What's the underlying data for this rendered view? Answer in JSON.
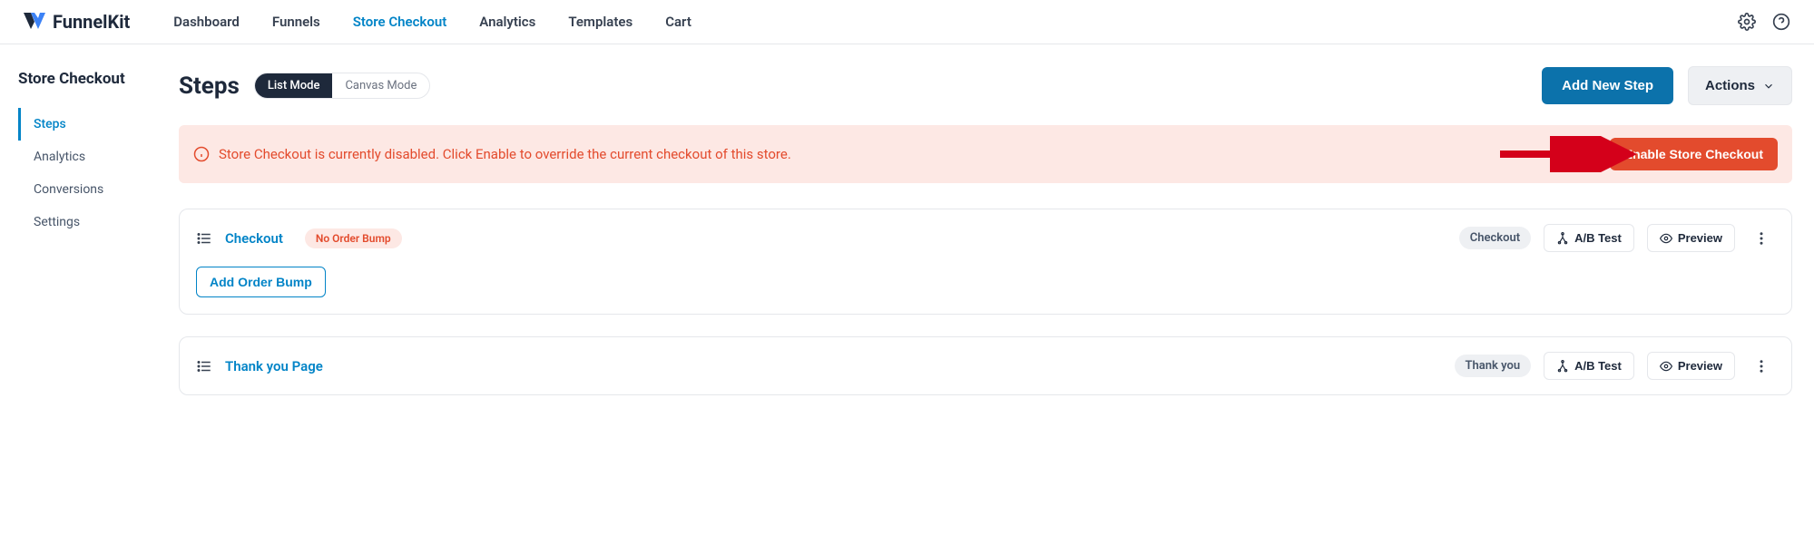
{
  "brand": {
    "name": "FunnelKit"
  },
  "nav": {
    "dashboard": "Dashboard",
    "funnels": "Funnels",
    "store_checkout": "Store Checkout",
    "analytics": "Analytics",
    "templates": "Templates",
    "cart": "Cart"
  },
  "sidebar": {
    "title": "Store Checkout",
    "steps": "Steps",
    "analytics": "Analytics",
    "conversions": "Conversions",
    "settings": "Settings"
  },
  "page": {
    "title": "Steps",
    "mode_list": "List Mode",
    "mode_canvas": "Canvas Mode",
    "add_new_step": "Add New Step",
    "actions": "Actions"
  },
  "alert": {
    "text": "Store Checkout is currently disabled. Click Enable to override the current checkout of this store.",
    "button": "Enable Store Checkout"
  },
  "step1": {
    "name": "Checkout",
    "badge": "No Order Bump",
    "type": "Checkout",
    "abtest": "A/B Test",
    "preview": "Preview",
    "add_bump": "Add Order Bump"
  },
  "step2": {
    "name": "Thank you Page",
    "type": "Thank you",
    "abtest": "A/B Test",
    "preview": "Preview"
  }
}
